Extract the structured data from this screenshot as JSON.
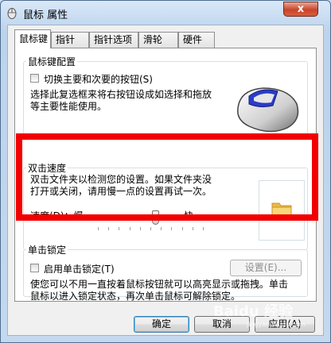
{
  "window": {
    "title": "鼠标 属性",
    "close_label": "x"
  },
  "tabs": [
    {
      "label": "鼠标键",
      "active": true
    },
    {
      "label": "指针",
      "active": false
    },
    {
      "label": "指针选项",
      "active": false
    },
    {
      "label": "滑轮",
      "active": false
    },
    {
      "label": "硬件",
      "active": false
    }
  ],
  "button_config": {
    "group_label": "鼠标键配置",
    "checkbox_label": "切换主要和次要的按钮(S)",
    "checked": false,
    "description_lines": [
      "选择此复选框来将右按钮设成如选择和拖放",
      "等主要性能使用。"
    ]
  },
  "double_click": {
    "group_label": "双击速度",
    "description_lines": [
      "双击文件夹以检测您的设置。如果文件夹没",
      "打开或关闭，请用慢一点的设置再试一次。"
    ],
    "speed_label": "速度(D)：慢",
    "fast_label": "快",
    "slider_value_fraction": 0.55
  },
  "click_lock": {
    "group_label": "单击锁定",
    "checkbox_label": "启用单击锁定(T)",
    "checked": false,
    "settings_label": "设置(E)...",
    "description_lines": [
      "使您可以不用一直按着鼠标按钮就可以高亮显示或拖拽。单击",
      "鼠标以进入锁定状态，再次单击鼠标可解除锁定。"
    ]
  },
  "footer": {
    "ok_label": "确定",
    "cancel_label": "取消",
    "apply_label": "应用(A)"
  },
  "watermark": {
    "text": "Baidu 经验",
    "sub": "jingyan.baidu.com"
  },
  "colors": {
    "highlight": "#f20000",
    "close_button": "#c9452b",
    "folder": "#f2c85b"
  }
}
